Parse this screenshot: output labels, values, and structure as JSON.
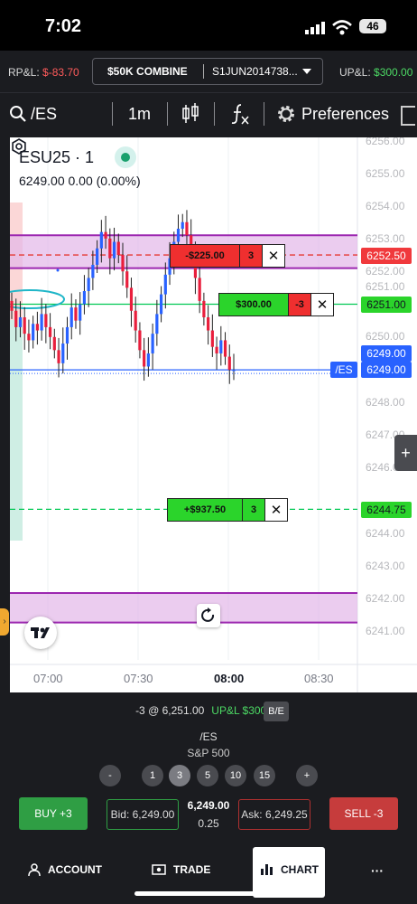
{
  "status": {
    "time": "7:02",
    "battery": "46"
  },
  "account": {
    "rpl_label": "RP&L:",
    "rpl_value": "$-83.70",
    "combine_label": "$50K COMBINE",
    "account_id": "S1JUN2014738...",
    "upl_label": "UP&L:",
    "upl_value": "$300.00"
  },
  "toolbar": {
    "symbol": "/ES",
    "timeframe": "1m",
    "preferences_label": "Preferences"
  },
  "chart_header": {
    "title": "ESU25 · 1",
    "quote": "6249.00  0.00 (0.00%)"
  },
  "chart_data": {
    "type": "candlestick",
    "x_tick_labels": [
      "07:00",
      "07:30",
      "08:00",
      "08:30"
    ],
    "y_tick_labels": [
      "6256.00",
      "6255.00",
      "6254.00",
      "6253.00",
      "6252.00",
      "6251.00",
      "6250.00",
      "6248.00",
      "6247.00",
      "6246.00",
      "6244.00",
      "6243.00",
      "6242.00",
      "6241.00"
    ],
    "ylim": [
      6240.7,
      6256.1
    ],
    "colors": {
      "up": "#2962ff",
      "down": "#e91e3c",
      "wick": "#222222"
    },
    "closes": [
      6250.8,
      6250.3,
      6250.6,
      6250.1,
      6249.9,
      6250.4,
      6250.2,
      6250.7,
      6250.3,
      6250.0,
      6249.6,
      6249.2,
      6249.8,
      6250.3,
      6250.9,
      6250.5,
      6251.0,
      6251.4,
      6251.8,
      6252.2,
      6252.7,
      6253.2,
      6253.0,
      6252.4,
      6252.9,
      6252.5,
      6252.0,
      6251.5,
      6250.8,
      6250.2,
      6249.6,
      6249.1,
      6249.5,
      6250.1,
      6250.7,
      6251.3,
      6251.9,
      6252.4,
      6252.9,
      6253.3,
      6253.5,
      6253.1,
      6252.6,
      6251.8,
      6251.1,
      6250.6,
      6250.2,
      6249.7,
      6249.5,
      6249.9,
      6249.4,
      6249.0,
      6249.0
    ],
    "levels": [
      {
        "price": 6252.5,
        "color": "#e53935",
        "style": "dashed"
      },
      {
        "price": 6251.0,
        "color": "#00c853",
        "style": "solid"
      },
      {
        "price": 6249.0,
        "color": "#2962ff",
        "style": "solid"
      },
      {
        "price": 6244.75,
        "color": "#00c853",
        "style": "dashed"
      }
    ],
    "zones": [
      {
        "top": 6253.1,
        "bottom": 6252.1,
        "color": "#e3b7e8"
      },
      {
        "top": 6242.2,
        "bottom": 6241.3,
        "color": "#e3b7e8"
      }
    ]
  },
  "price_tags": {
    "stop_price": "6252.50",
    "entry_price": "6251.00",
    "last_price": "6249.00",
    "sym_badge": "/ES",
    "mark_price": "6249.00",
    "target_price": "6244.75"
  },
  "orders": [
    {
      "amount": "-$225.00",
      "qty": "3",
      "close": "✕"
    },
    {
      "amount": "$300.00",
      "qty": "-3",
      "close": "✕"
    },
    {
      "amount": "+$937.50",
      "qty": "3",
      "close": "✕"
    }
  ],
  "position": {
    "text": "-3 @ 6,251.00",
    "upl": "UP&L $300.00",
    "be_label": "B/E"
  },
  "instrument": {
    "symbol": "/ES",
    "name": "S&P 500"
  },
  "qty_buttons": [
    "-",
    "1",
    "3",
    "5",
    "10",
    "15",
    "+"
  ],
  "trade": {
    "buy_label": "BUY +3",
    "bid": "Bid: 6,249.00",
    "last": "6,249.00",
    "tick": "0.25",
    "ask": "Ask: 6,249.25",
    "sell_label": "SELL -3"
  },
  "nav": {
    "account": "ACCOUNT",
    "trade": "TRADE",
    "chart": "CHART",
    "more": "···"
  }
}
